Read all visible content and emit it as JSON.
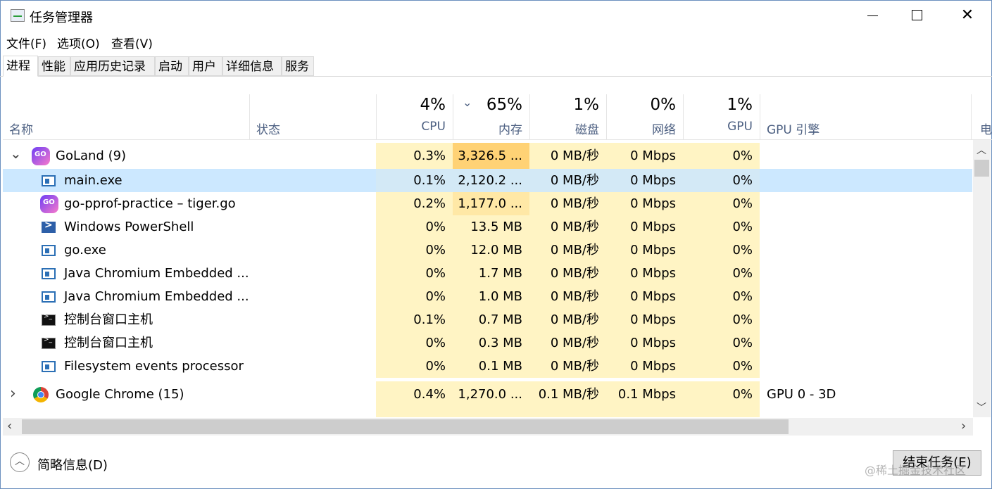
{
  "window": {
    "title": "任务管理器"
  },
  "menu": [
    "文件(F)",
    "选项(O)",
    "查看(V)"
  ],
  "tabs": [
    "进程",
    "性能",
    "应用历史记录",
    "启动",
    "用户",
    "详细信息",
    "服务"
  ],
  "header": {
    "name": "名称",
    "status": "状态",
    "cpu_pct": "4%",
    "cpu": "CPU",
    "mem_pct": "65%",
    "mem": "内存",
    "disk_pct": "1%",
    "disk": "磁盘",
    "net_pct": "0%",
    "net": "网络",
    "gpu_pct": "1%",
    "gpu": "GPU",
    "gpu_engine": "GPU 引擎",
    "power": "电"
  },
  "rows": [
    {
      "name": "GoLand (9)",
      "cpu": "0.3%",
      "mem": "3,326.5 ...",
      "disk": "0 MB/秒",
      "net": "0 Mbps",
      "gpu": "0%",
      "engine": "",
      "icon": "goland-icon"
    },
    {
      "name": "main.exe",
      "cpu": "0.1%",
      "mem": "2,120.2 ...",
      "disk": "0 MB/秒",
      "net": "0 Mbps",
      "gpu": "0%",
      "engine": "",
      "icon": "app-window-icon"
    },
    {
      "name": "go-pprof-practice – tiger.go",
      "cpu": "0.2%",
      "mem": "1,177.0 ...",
      "disk": "0 MB/秒",
      "net": "0 Mbps",
      "gpu": "0%",
      "engine": "",
      "icon": "goland-icon"
    },
    {
      "name": "Windows PowerShell",
      "cpu": "0%",
      "mem": "13.5 MB",
      "disk": "0 MB/秒",
      "net": "0 Mbps",
      "gpu": "0%",
      "engine": "",
      "icon": "powershell-icon"
    },
    {
      "name": "go.exe",
      "cpu": "0%",
      "mem": "12.0 MB",
      "disk": "0 MB/秒",
      "net": "0 Mbps",
      "gpu": "0%",
      "engine": "",
      "icon": "app-window-icon"
    },
    {
      "name": "Java Chromium Embedded ...",
      "cpu": "0%",
      "mem": "1.7 MB",
      "disk": "0 MB/秒",
      "net": "0 Mbps",
      "gpu": "0%",
      "engine": "",
      "icon": "app-window-icon"
    },
    {
      "name": "Java Chromium Embedded ...",
      "cpu": "0%",
      "mem": "1.0 MB",
      "disk": "0 MB/秒",
      "net": "0 Mbps",
      "gpu": "0%",
      "engine": "",
      "icon": "app-window-icon"
    },
    {
      "name": "控制台窗口主机",
      "cpu": "0.1%",
      "mem": "0.7 MB",
      "disk": "0 MB/秒",
      "net": "0 Mbps",
      "gpu": "0%",
      "engine": "",
      "icon": "console-icon"
    },
    {
      "name": "控制台窗口主机",
      "cpu": "0%",
      "mem": "0.3 MB",
      "disk": "0 MB/秒",
      "net": "0 Mbps",
      "gpu": "0%",
      "engine": "",
      "icon": "console-icon"
    },
    {
      "name": "Filesystem events processor",
      "cpu": "0%",
      "mem": "0.1 MB",
      "disk": "0 MB/秒",
      "net": "0 Mbps",
      "gpu": "0%",
      "engine": "",
      "icon": "app-window-icon"
    },
    {
      "name": "Google Chrome (15)",
      "cpu": "0.4%",
      "mem": "1,270.0 ...",
      "disk": "0.1 MB/秒",
      "net": "0.1 Mbps",
      "gpu": "0%",
      "engine": "GPU 0 - 3D",
      "icon": "chrome-icon"
    }
  ],
  "footer": {
    "summary": "简略信息(D)",
    "end_task": "结束任务(E)",
    "watermark": "@稀土掘金技术社区"
  },
  "colors": {
    "cpu_bg": "#fff4c4",
    "mem_hot": "#ffd275",
    "mem_warm": "#ffe8a6",
    "selected": "#cce8ff"
  }
}
